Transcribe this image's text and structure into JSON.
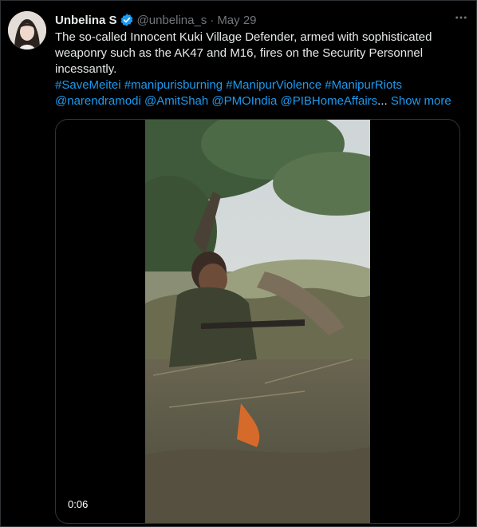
{
  "tweet": {
    "author_name": "Unbelina S",
    "handle": "@unbelina_s",
    "separator": "·",
    "date": "May 29",
    "more_icon": "more-horizontal-icon",
    "text": "The so-called Innocent Kuki Village  Defender, armed with sophisticated weaponry such as the AK47 and M16,  fires on the Security Personnel incessantly.",
    "hashtags_line": [
      "#SaveMeitei",
      "#manipurisburning",
      "#ManipurViolence",
      "#ManipurRiots"
    ],
    "mentions_line": [
      "@narendramodi",
      "@AmitShah",
      "@PMOIndia",
      "@PIBHomeAffairs"
    ],
    "ellipsis": "...",
    "show_more": "Show more",
    "colors": {
      "link": "#1d9bf0",
      "verified": "#1d9bf0",
      "muted": "#71767b"
    }
  },
  "media": {
    "duration": "0:06"
  }
}
